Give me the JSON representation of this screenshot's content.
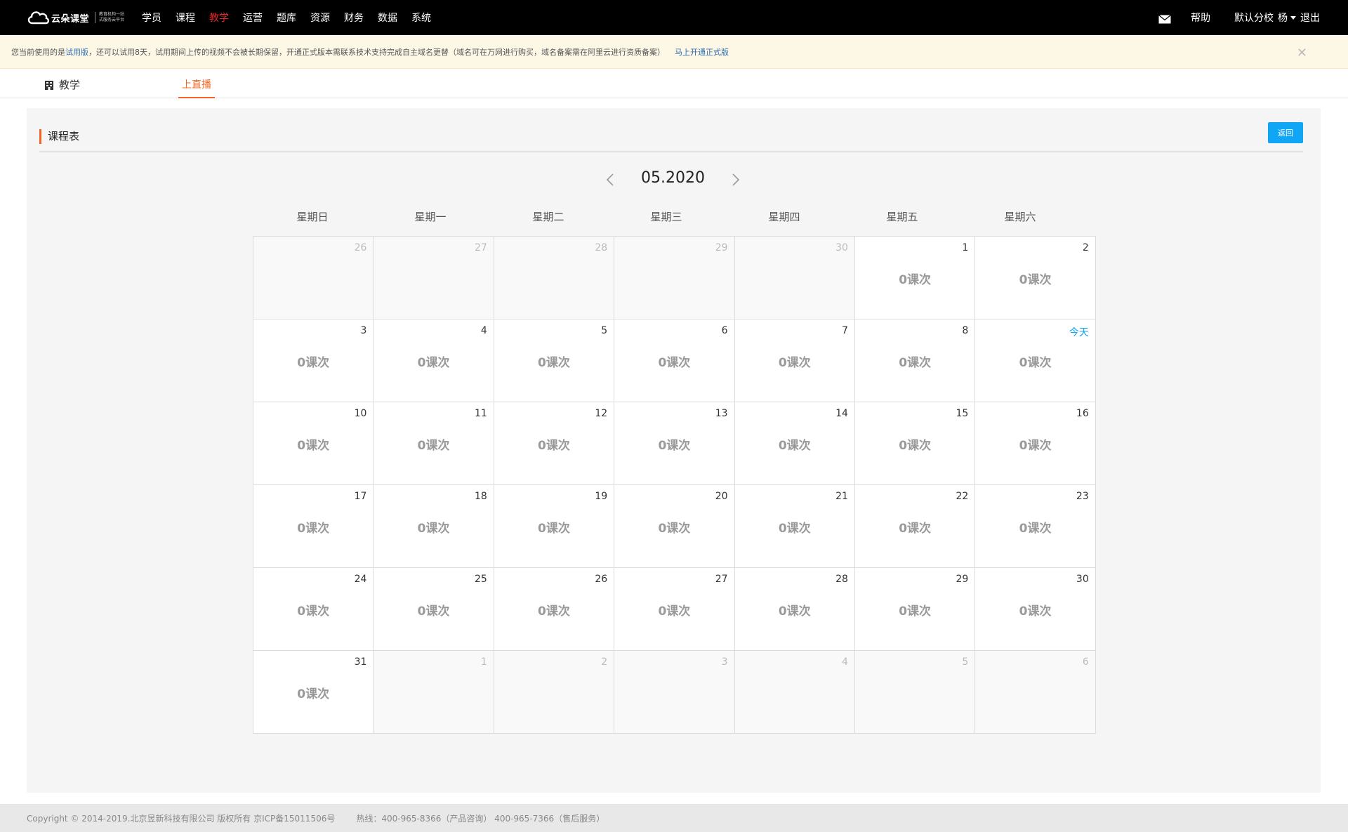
{
  "app": {
    "brand_name": "云朵课堂",
    "brand_sub1": "教育机构一站",
    "brand_sub2": "式服务云平台",
    "brand_url": "yunduoketang.com"
  },
  "nav": {
    "items": [
      {
        "label": "学员"
      },
      {
        "label": "课程"
      },
      {
        "label": "教学",
        "active": true
      },
      {
        "label": "运营"
      },
      {
        "label": "题库"
      },
      {
        "label": "资源"
      },
      {
        "label": "财务"
      },
      {
        "label": "数据"
      },
      {
        "label": "系统"
      }
    ],
    "help": "帮助",
    "school": "默认分校",
    "user": "杨",
    "logout": "退出",
    "active_color": "#e4262b"
  },
  "notice": {
    "text1": "您当前使用的是",
    "trial_link": "试用版",
    "text2": "，还可以试用8天，试用期间上传的视频不会被长期保留，开通正式版本需联系技术支持完成自主域名更替（域名可在万网进行购买，域名备案需在阿里云进行资质备案）",
    "upgrade_link": "马上开通正式版",
    "close": "✕"
  },
  "subtabs": {
    "home": "教学",
    "live": "上直播"
  },
  "panel": {
    "title": "课程表",
    "back_button": "返回",
    "month_label": "05.2020",
    "accent_color": "#f26522",
    "button_color": "#10a5f5"
  },
  "calendar": {
    "weekdays": [
      "星期日",
      "星期一",
      "星期二",
      "星期三",
      "星期四",
      "星期五",
      "星期六"
    ],
    "cells": [
      {
        "day": "26",
        "other": true,
        "count": ""
      },
      {
        "day": "27",
        "other": true,
        "count": ""
      },
      {
        "day": "28",
        "other": true,
        "count": ""
      },
      {
        "day": "29",
        "other": true,
        "count": ""
      },
      {
        "day": "30",
        "other": true,
        "count": ""
      },
      {
        "day": "1",
        "other": false,
        "count": "0课次"
      },
      {
        "day": "2",
        "other": false,
        "count": "0课次"
      },
      {
        "day": "3",
        "other": false,
        "count": "0课次"
      },
      {
        "day": "4",
        "other": false,
        "count": "0课次"
      },
      {
        "day": "5",
        "other": false,
        "count": "0课次"
      },
      {
        "day": "6",
        "other": false,
        "count": "0课次"
      },
      {
        "day": "7",
        "other": false,
        "count": "0课次"
      },
      {
        "day": "8",
        "other": false,
        "count": "0课次"
      },
      {
        "day": "今天",
        "other": false,
        "today": true,
        "count": "0课次"
      },
      {
        "day": "10",
        "other": false,
        "count": "0课次"
      },
      {
        "day": "11",
        "other": false,
        "count": "0课次"
      },
      {
        "day": "12",
        "other": false,
        "count": "0课次"
      },
      {
        "day": "13",
        "other": false,
        "count": "0课次"
      },
      {
        "day": "14",
        "other": false,
        "count": "0课次"
      },
      {
        "day": "15",
        "other": false,
        "count": "0课次"
      },
      {
        "day": "16",
        "other": false,
        "count": "0课次"
      },
      {
        "day": "17",
        "other": false,
        "count": "0课次"
      },
      {
        "day": "18",
        "other": false,
        "count": "0课次"
      },
      {
        "day": "19",
        "other": false,
        "count": "0课次"
      },
      {
        "day": "20",
        "other": false,
        "count": "0课次"
      },
      {
        "day": "21",
        "other": false,
        "count": "0课次"
      },
      {
        "day": "22",
        "other": false,
        "count": "0课次"
      },
      {
        "day": "23",
        "other": false,
        "count": "0课次"
      },
      {
        "day": "24",
        "other": false,
        "count": "0课次"
      },
      {
        "day": "25",
        "other": false,
        "count": "0课次"
      },
      {
        "day": "26",
        "other": false,
        "count": "0课次"
      },
      {
        "day": "27",
        "other": false,
        "count": "0课次"
      },
      {
        "day": "28",
        "other": false,
        "count": "0课次"
      },
      {
        "day": "29",
        "other": false,
        "count": "0课次"
      },
      {
        "day": "30",
        "other": false,
        "count": "0课次"
      },
      {
        "day": "31",
        "other": false,
        "count": "0课次"
      },
      {
        "day": "1",
        "other": true,
        "count": ""
      },
      {
        "day": "2",
        "other": true,
        "count": ""
      },
      {
        "day": "3",
        "other": true,
        "count": ""
      },
      {
        "day": "4",
        "other": true,
        "count": ""
      },
      {
        "day": "5",
        "other": true,
        "count": ""
      },
      {
        "day": "6",
        "other": true,
        "count": ""
      }
    ]
  },
  "footer": {
    "copyright": "Copyright © 2014-2019.北京昱新科技有限公司 版权所有 京ICP备15011506号",
    "hotline": "热线：400-965-8366（产品咨询） 400-965-7366（售后服务）"
  },
  "icons": [
    "mail-icon",
    "close-icon",
    "building-icon",
    "chevron-left-icon",
    "chevron-right-icon",
    "caret-down-icon",
    "cloud-logo-icon"
  ]
}
